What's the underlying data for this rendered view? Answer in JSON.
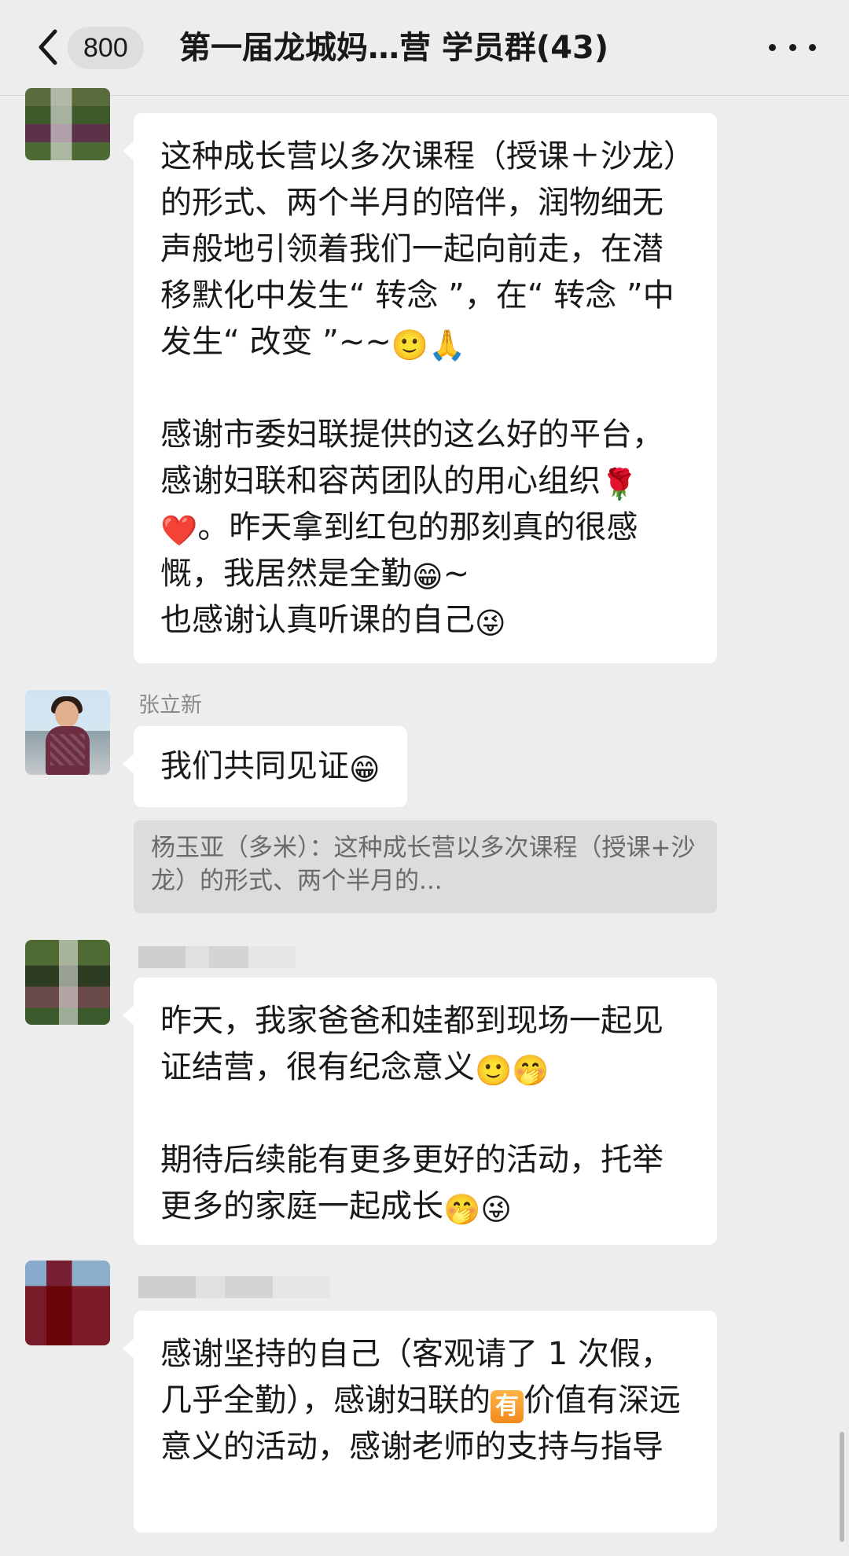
{
  "header": {
    "back_icon": "chevron-left-icon",
    "unread_count": "800",
    "title": "第一届龙城妈…营 学员群(43)",
    "more_icon": "more-dots-icon"
  },
  "messages": [
    {
      "sender": "杨玉亚（多米）",
      "sender_visible": false,
      "paragraphs": [
        "这种成长营以多次课程（授课＋沙龙）的形式、两个半月的陪伴，润物细无声般地引领着我们一起向前走，在潜移默化中发生“ 转念 ”，在“ 转念 ”中发生“ 改变 ”~~",
        "感谢市委妇联提供的这么好的平台，感谢妇联和容芮团队的用心组织",
        "。昨天拿到红包的那刻真的很感慨，我居然是全勤",
        "~",
        "也感谢认真听课的自己"
      ],
      "emojis": {
        "a": "🙂",
        "b": "🙏",
        "rose": "🌹",
        "heart": "❤️",
        "grin": "😁",
        "tongue": "😜"
      }
    },
    {
      "sender": "张立新",
      "text": "我们共同见证",
      "emoji": "😁",
      "quote": "杨玉亚（多米）：这种成长营以多次课程（授课+沙龙）的形式、两个半月的..."
    },
    {
      "sender": "杨玉亚（多米）",
      "paragraph1": "昨天，我家爸爸和娃都到现场一起见证结营，很有纪念意义",
      "paragraph2": "期待后续能有更多更好的活动，托举更多的家庭一起成长",
      "emojis": {
        "a": "🙂",
        "b": "🤭",
        "c": "🤭",
        "d": "😜"
      }
    },
    {
      "text_before": "感谢坚持的自己（客观请了 1 次假，几乎全勤），感谢妇联的",
      "badge": "有",
      "text_after": "价值有深远意义的活动，感谢老师的支持与指导"
    }
  ]
}
